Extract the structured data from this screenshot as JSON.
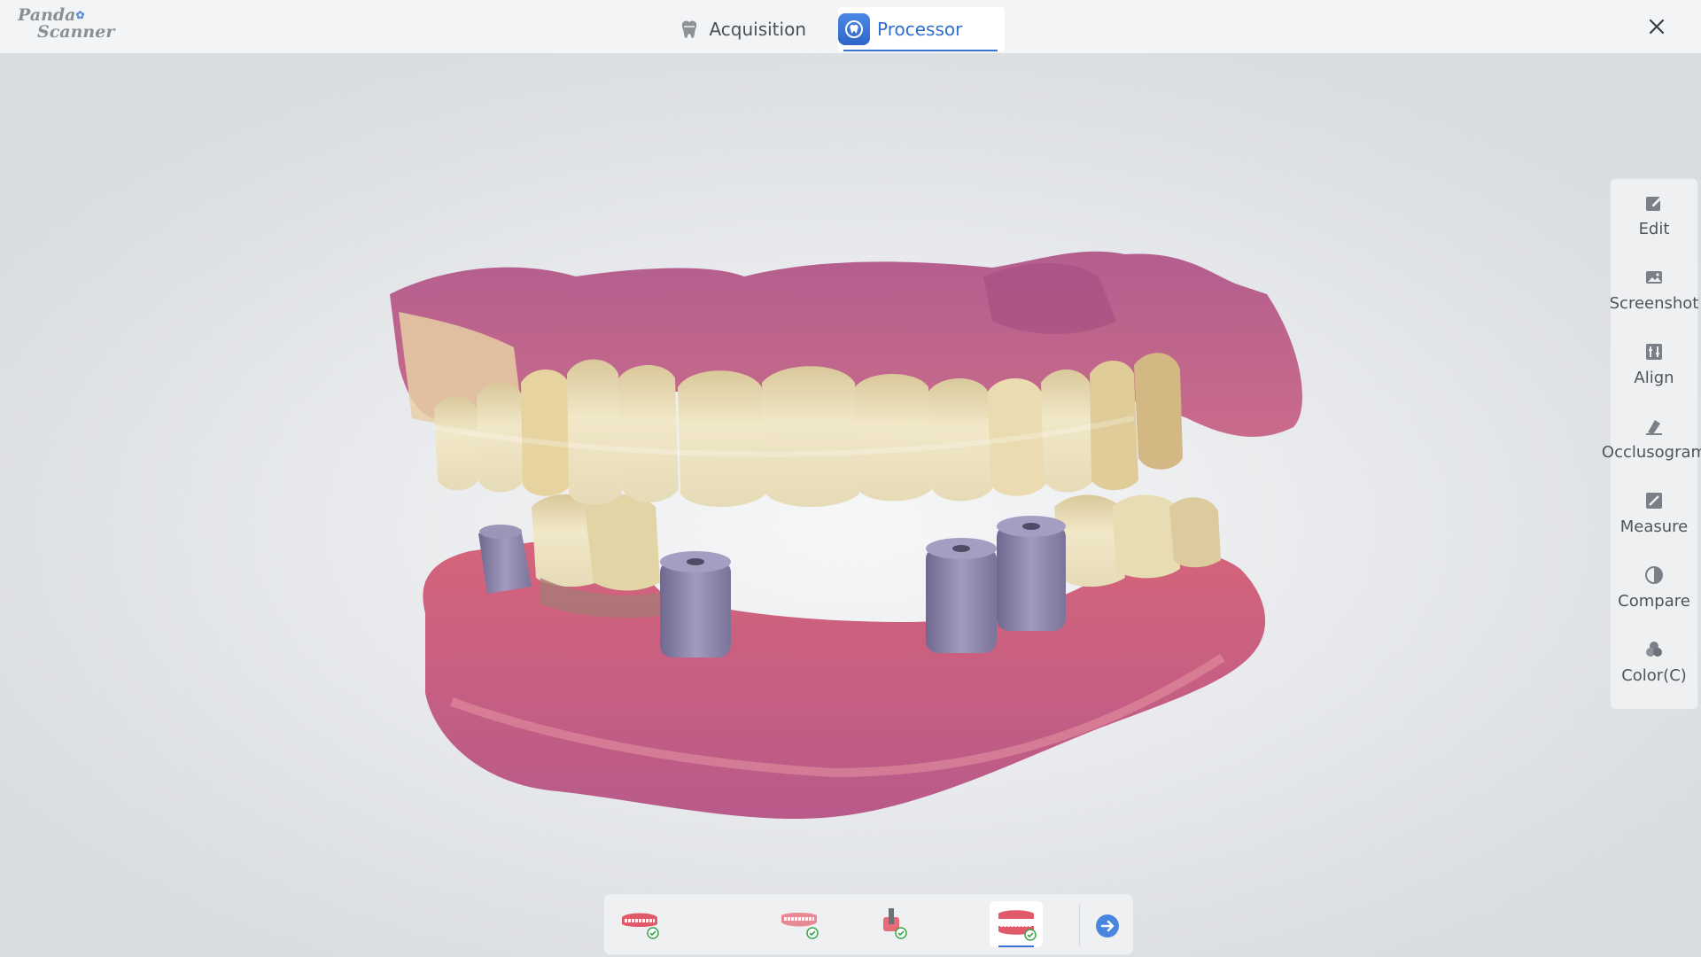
{
  "app": {
    "logo_line1": "Panda",
    "logo_line2": "Scanner"
  },
  "tabs": [
    {
      "label": "Acquisition",
      "icon": "tooth-icon",
      "active": false
    },
    {
      "label": "Processor",
      "icon": "processor-icon",
      "active": true
    }
  ],
  "toolbar": {
    "items": [
      {
        "label": "Edit",
        "icon": "edit-icon"
      },
      {
        "label": "Screenshot",
        "icon": "image-icon"
      },
      {
        "label": "Align",
        "icon": "align-icon"
      },
      {
        "label": "Occlusogram",
        "icon": "occlusogram-icon"
      },
      {
        "label": "Measure",
        "icon": "measure-icon"
      },
      {
        "label": "Compare",
        "icon": "compare-icon"
      },
      {
        "label": "Color(C)",
        "icon": "color-icon"
      }
    ]
  },
  "bottom_bar": {
    "items": [
      {
        "icon": "upper-jaw-check-icon",
        "active": false
      },
      {
        "icon": "lower-jaw-check-icon",
        "active": false
      },
      {
        "icon": "scanbody-check-icon",
        "active": false
      },
      {
        "icon": "bite-check-icon",
        "active": true
      }
    ],
    "next_icon": "arrow-right-icon"
  },
  "colors": {
    "accent": "#3a73d4",
    "gum": "#d4708e",
    "tooth": "#efe3c0",
    "scanbody": "#8b82a8"
  }
}
